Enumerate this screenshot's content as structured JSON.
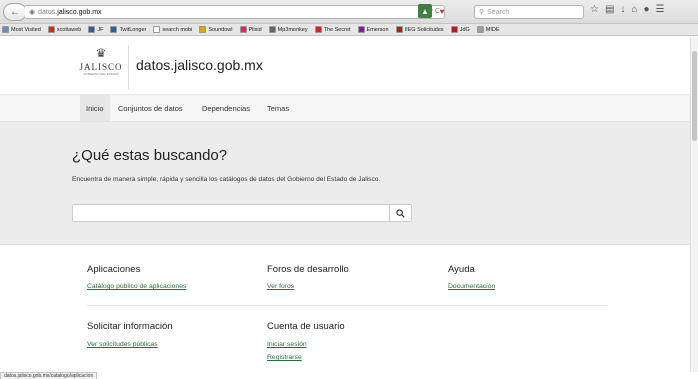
{
  "browser": {
    "url_prefix": "datos.",
    "url_host": "jalisco.gob.mx",
    "search_placeholder": "Search",
    "bookmarks": [
      {
        "label": "Most Visited",
        "color": "#6c8ebf"
      },
      {
        "label": "scotiaweb",
        "color": "#d9261c"
      },
      {
        "label": "JF",
        "color": "#3b5998"
      },
      {
        "label": "TwitLonger",
        "color": "#2b5ea7"
      },
      {
        "label": "search mobi",
        "color": "#ffffff"
      },
      {
        "label": "Soundowl",
        "color": "#e0a800"
      },
      {
        "label": "Plixid",
        "color": "#e91e63"
      },
      {
        "label": "Mp3monkey",
        "color": "#666666"
      },
      {
        "label": "The Secret",
        "color": "#c62828"
      },
      {
        "label": "Emerson",
        "color": "#7b1fa2"
      },
      {
        "label": "IIEG Solicitudes",
        "color": "#b71c1c"
      },
      {
        "label": "JdG",
        "color": "#b71c1c"
      },
      {
        "label": "MIDE",
        "color": "#9e9e9e"
      }
    ]
  },
  "header": {
    "logo_text": "JALISCO",
    "logo_subtext": "GOBIERNO DEL ESTADO",
    "site_title": "datos.jalisco.gob.mx"
  },
  "nav": [
    {
      "label": "Inicio",
      "active": true
    },
    {
      "label": "Conjuntos de datos",
      "active": false
    },
    {
      "label": "Dependencias",
      "active": false
    },
    {
      "label": "Temas",
      "active": false
    }
  ],
  "hero": {
    "title": "¿Qué estas buscando?",
    "description": "Encuentra de manera simple, rápida y sencilla los catálogos de datos del Gobierno del Estado de Jalisco."
  },
  "sections": {
    "apps": {
      "heading": "Aplicaciones",
      "link": "Catálogo público de aplicaciones"
    },
    "forums": {
      "heading": "Foros de desarrollo",
      "link": "Ver foros"
    },
    "help": {
      "heading": "Ayuda",
      "link": "Documentación"
    },
    "request": {
      "heading": "Solicitar información",
      "link": "Ver solicitudes públicas"
    },
    "account": {
      "heading": "Cuenta de usuario",
      "login": "Iniciar sesión",
      "register": "Registrarse"
    }
  },
  "status_bar": "datos.jalisco.gob.mx/catalogo/aplicacion"
}
